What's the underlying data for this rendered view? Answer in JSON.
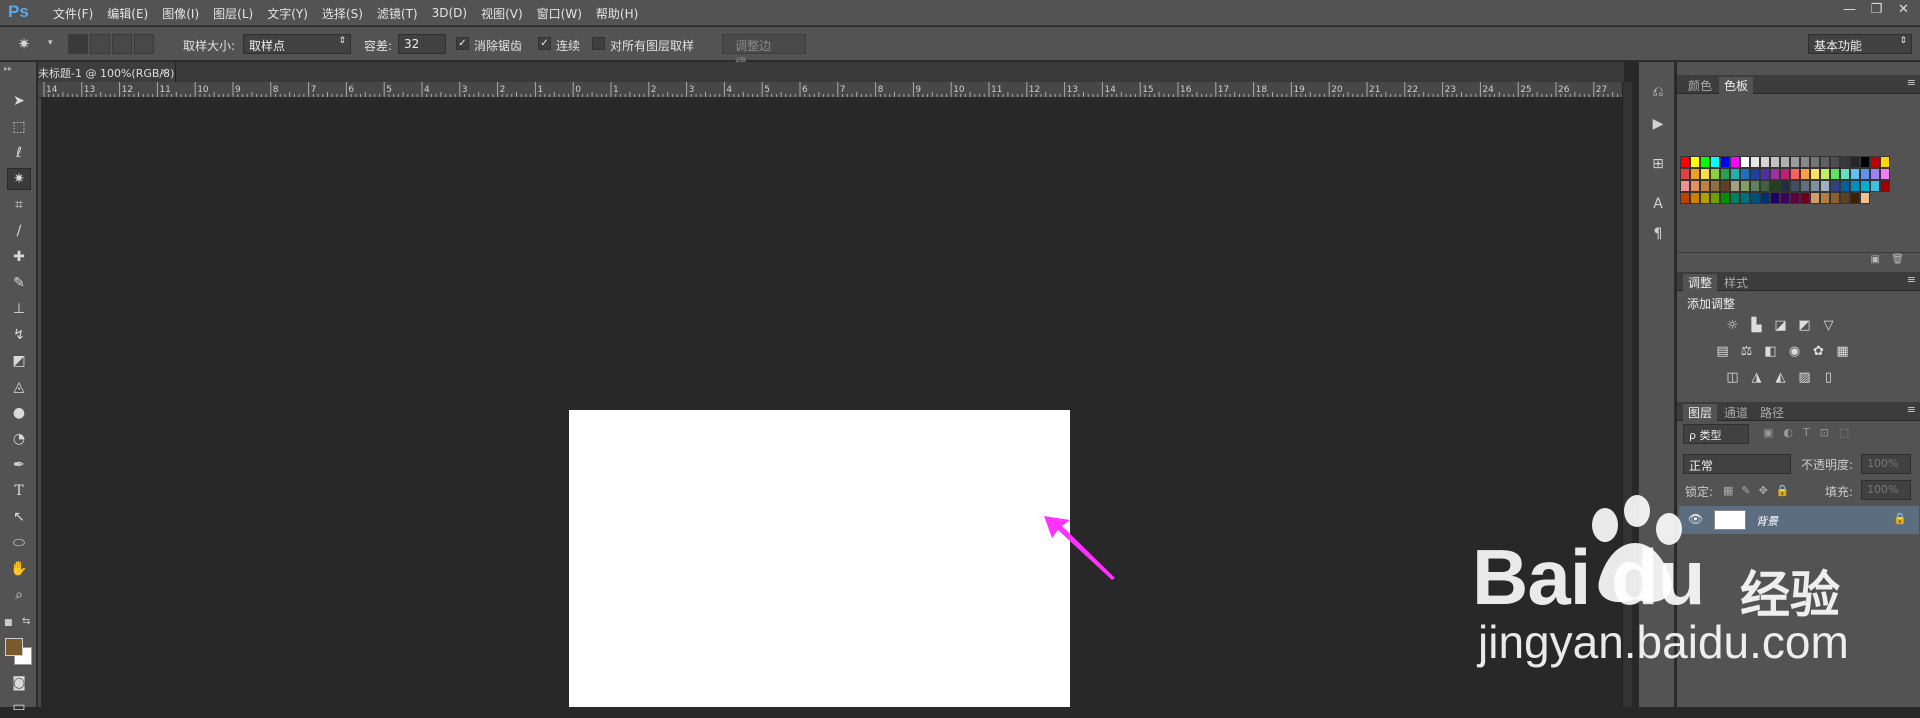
{
  "app": {
    "logo": "Ps",
    "menus": [
      "文件(F)",
      "编辑(E)",
      "图像(I)",
      "图层(L)",
      "文字(Y)",
      "选择(S)",
      "滤镜(T)",
      "3D(D)",
      "视图(V)",
      "窗口(W)",
      "帮助(H)"
    ]
  },
  "window_controls": [
    "—",
    "❐",
    "✕"
  ],
  "options": {
    "sample_size_label": "取样大小:",
    "sample_size_value": "取样点",
    "tolerance_label": "容差:",
    "tolerance_value": "32",
    "antialias_label": "消除锯齿",
    "antialias_checked": true,
    "contiguous_label": "连续",
    "contiguous_checked": true,
    "all_layers_label": "对所有图层取样",
    "all_layers_checked": false,
    "refine_edge_label": "调整边缘...",
    "workspace": "基本功能"
  },
  "document_tab": {
    "title": "未标题-1 @ 100%(RGB/8)",
    "close": "×"
  },
  "ruler": {
    "labels": [
      "14",
      "13",
      "12",
      "11",
      "10",
      "9",
      "8",
      "7",
      "6",
      "5",
      "4",
      "3",
      "2",
      "1",
      "0",
      "1",
      "2",
      "3",
      "4",
      "5",
      "6",
      "7",
      "8",
      "9",
      "10",
      "11",
      "12",
      "13",
      "14",
      "15",
      "16",
      "17",
      "18",
      "19",
      "20",
      "21",
      "22",
      "23",
      "24",
      "25",
      "26",
      "27"
    ]
  },
  "panels": {
    "color_tabs": [
      "颜色",
      "色板"
    ],
    "adjust_tabs": [
      "调整",
      "样式"
    ],
    "adjust_title": "添加调整",
    "layer_tabs": [
      "图层",
      "通道",
      "路径"
    ],
    "layer_filter": "ρ 类型",
    "blend_mode": "正常",
    "opacity_label": "不透明度:",
    "opacity_value": "100%",
    "lock_label": "锁定:",
    "fill_label": "填充:",
    "fill_value": "100%",
    "layers": [
      {
        "name": "背景",
        "visible": true,
        "locked": true
      }
    ]
  },
  "swatches": [
    "#ff0000",
    "#ffff00",
    "#00ff00",
    "#00ffff",
    "#0000ff",
    "#ff00ff",
    "#ffffff",
    "#e6e6e6",
    "#d4d4d4",
    "#c2c2c2",
    "#b0b0b0",
    "#9c9c9c",
    "#888888",
    "#747474",
    "#606060",
    "#4d4d4d",
    "#3a3a3a",
    "#262626",
    "#000000",
    "#c30000",
    "#ffd700",
    "#e04040",
    "#f0a020",
    "#f5e04a",
    "#8cd040",
    "#2ca050",
    "#20b0b0",
    "#2070c0",
    "#2040a0",
    "#5030a0",
    "#a030a0",
    "#c02070",
    "#ff6060",
    "#ffa040",
    "#ffe060",
    "#c0f060",
    "#60e060",
    "#60e0c0",
    "#60c0f0",
    "#6090f0",
    "#a080f0",
    "#f080f0",
    "#f09090",
    "#e09060",
    "#c08040",
    "#907040",
    "#604020",
    "#a0a080",
    "#80a060",
    "#608060",
    "#406040",
    "#204020",
    "#203040",
    "#405060",
    "#607080",
    "#8090a0",
    "#a0b0c0",
    "#304080",
    "#0060a0",
    "#0090c0",
    "#00b0d0",
    "#40c0e0",
    "#a00000",
    "#c04000",
    "#d08000",
    "#b0a000",
    "#70a000",
    "#009000",
    "#008060",
    "#007080",
    "#005080",
    "#003070",
    "#200060",
    "#400060",
    "#600040",
    "#700020",
    "#d0a060",
    "#b08040",
    "#8a6030",
    "#604020",
    "#402000",
    "#f0c090"
  ],
  "watermark": {
    "brand": "Bai  du",
    "product": "经验",
    "url": "jingyan.baidu.com"
  },
  "colors": {
    "accent": "#ff33ff",
    "ui_bg": "#535353",
    "workspace_bg": "#282828"
  }
}
